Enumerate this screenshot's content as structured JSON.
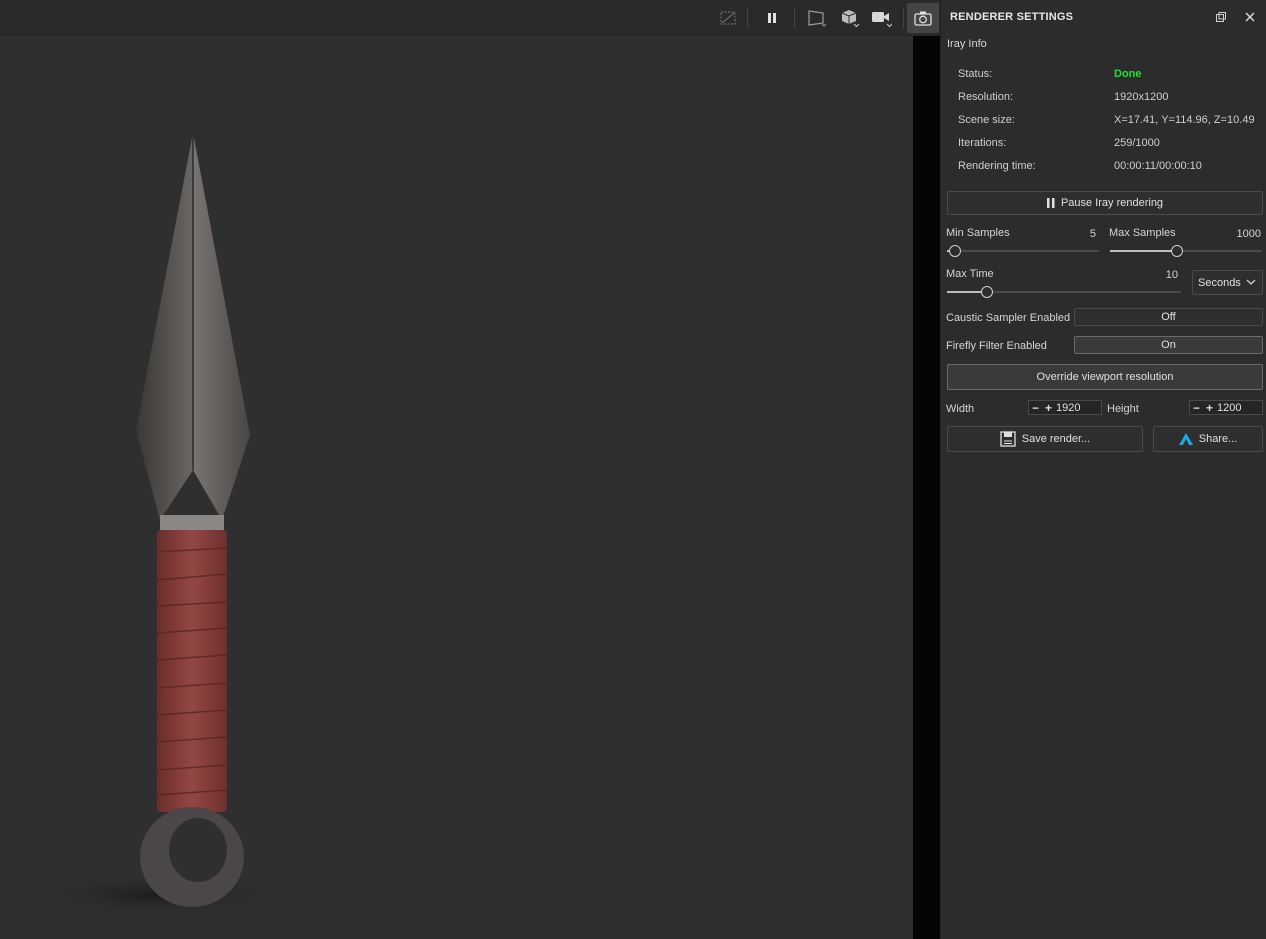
{
  "toolbar": {
    "icons": [
      "aux-viewport-icon",
      "pause-icon",
      "frame-icon",
      "cube-icon",
      "camera-video-icon",
      "camera-snapshot-icon"
    ]
  },
  "panel": {
    "title": "RENDERER SETTINGS",
    "section": "Iray Info",
    "info": [
      {
        "key": "Status:",
        "value": "Done"
      },
      {
        "key": "Resolution:",
        "value": "1920x1200"
      },
      {
        "key": "Scene size:",
        "value": "X=17.41, Y=114.96, Z=10.49"
      },
      {
        "key": "Iterations:",
        "value": "259/1000"
      },
      {
        "key": "Rendering time:",
        "value": "00:00:11/00:00:10"
      }
    ],
    "pause_button": "Pause Iray rendering",
    "min_samples": {
      "label": "Min Samples",
      "value": "5",
      "level": 0.05
    },
    "max_samples": {
      "label": "Max Samples",
      "value": "1000",
      "level": 0.44
    },
    "max_time": {
      "label": "Max Time",
      "value": "10",
      "level": 0.17,
      "unit": "Seconds"
    },
    "caustic": {
      "label": "Caustic Sampler Enabled",
      "value": "Off"
    },
    "firefly": {
      "label": "Firefly Filter Enabled",
      "value": "On"
    },
    "override_button": "Override viewport resolution",
    "width": {
      "label": "Width",
      "value": "1920"
    },
    "height": {
      "label": "Height",
      "value": "1200"
    },
    "save_button": "Save render...",
    "share_button": "Share..."
  },
  "colors": {
    "status_done": "#25e034",
    "share_accent": "#1ea7e0"
  }
}
